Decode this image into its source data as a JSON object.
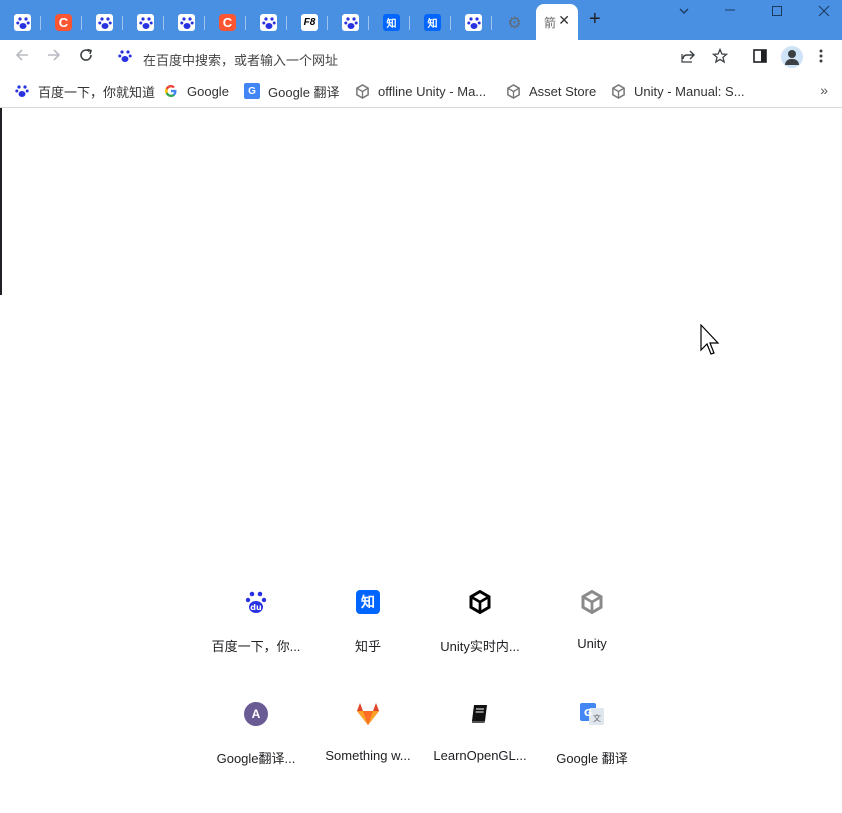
{
  "tabs": [
    {
      "icon": "baidu-paw-icon"
    },
    {
      "icon": "csdn-icon",
      "glyph": "C"
    },
    {
      "icon": "baidu-paw-icon"
    },
    {
      "icon": "baidu-paw-icon"
    },
    {
      "icon": "baidu-paw-icon"
    },
    {
      "icon": "csdn-icon",
      "glyph": "C"
    },
    {
      "icon": "baidu-paw-icon"
    },
    {
      "icon": "f8-icon",
      "glyph": "F8"
    },
    {
      "icon": "baidu-paw-icon"
    },
    {
      "icon": "zhihu-icon",
      "glyph": "知"
    },
    {
      "icon": "zhihu-icon",
      "glyph": "知"
    },
    {
      "icon": "baidu-paw-icon"
    },
    {
      "icon": "gear-icon"
    }
  ],
  "active_tab": {
    "title": "箭",
    "close": "✕"
  },
  "new_tab": "+",
  "window_controls": {
    "minimize": "⌄",
    "min": "—",
    "max": "☐",
    "close": "✕"
  },
  "omnibox": {
    "placeholder": "在百度中搜索，或者输入一个网址"
  },
  "bookmarks": [
    {
      "label": "百度一下，你就知道",
      "icon": "baidu-paw-icon"
    },
    {
      "label": "Google",
      "icon": "google-g-icon"
    },
    {
      "label": "Google 翻译",
      "icon": "google-translate-icon"
    },
    {
      "label": "offline Unity - Ma...",
      "icon": "unity-icon"
    },
    {
      "label": "Asset Store",
      "icon": "unity-icon"
    },
    {
      "label": "Unity - Manual: S...",
      "icon": "unity-icon"
    }
  ],
  "shortcuts": [
    {
      "label": "百度一下，你...",
      "icon": "baidu-du-icon"
    },
    {
      "label": "知乎",
      "icon": "zhihu-icon",
      "glyph": "知"
    },
    {
      "label": "Unity实时内...",
      "icon": "unity-black-icon"
    },
    {
      "label": "Unity",
      "icon": "unity-gray-icon"
    },
    {
      "label": "Google翻译...",
      "icon": "letter-a-avatar-icon",
      "glyph": "A"
    },
    {
      "label": "Something w...",
      "icon": "gitlab-fox-icon"
    },
    {
      "label": "LearnOpenGL...",
      "icon": "book-icon"
    },
    {
      "label": "Google 翻译",
      "icon": "google-translate-icon"
    }
  ],
  "colors": {
    "tabstrip": "#4a90e2",
    "baidu": "#2932e1",
    "csdn": "#fc5531",
    "zhihu": "#0066ff"
  }
}
